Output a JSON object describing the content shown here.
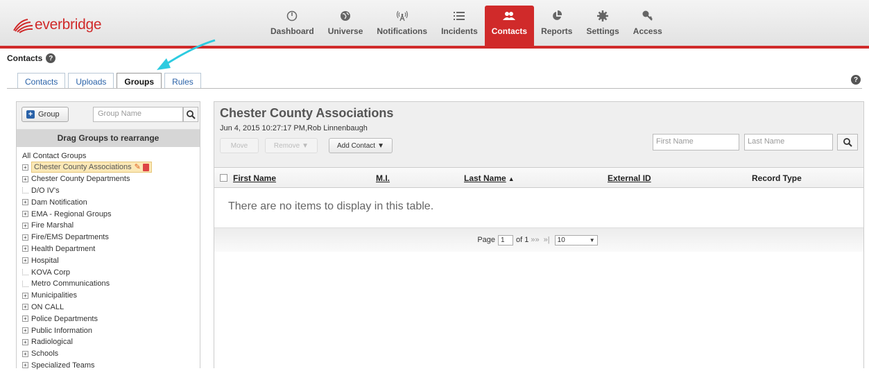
{
  "brand": {
    "logo_text": "everbridge",
    "accent": "#d02a2a",
    "link": "#2a62a8"
  },
  "nav": [
    {
      "label": "Dashboard",
      "icon": "dashboard-icon"
    },
    {
      "label": "Universe",
      "icon": "globe-icon"
    },
    {
      "label": "Notifications",
      "icon": "broadcast-icon"
    },
    {
      "label": "Incidents",
      "icon": "list-icon"
    },
    {
      "label": "Contacts",
      "icon": "people-icon",
      "active": true
    },
    {
      "label": "Reports",
      "icon": "pie-chart-icon"
    },
    {
      "label": "Settings",
      "icon": "gear-icon"
    },
    {
      "label": "Access",
      "icon": "key-icon"
    }
  ],
  "page": {
    "title": "Contacts",
    "help": "?"
  },
  "tabs": [
    {
      "label": "Contacts"
    },
    {
      "label": "Uploads"
    },
    {
      "label": "Groups",
      "active": true
    },
    {
      "label": "Rules"
    }
  ],
  "left": {
    "add_button": "Group",
    "search_placeholder": "Group Name",
    "drag_header": "Drag Groups to rearrange",
    "root": "All Contact Groups",
    "groups": [
      {
        "label": "Chester County Associations",
        "expandable": true,
        "selected": true
      },
      {
        "label": "Chester County Departments",
        "expandable": true
      },
      {
        "label": "D/O IV's",
        "expandable": false
      },
      {
        "label": "Dam Notification",
        "expandable": true
      },
      {
        "label": "EMA - Regional Groups",
        "expandable": true
      },
      {
        "label": "Fire Marshal",
        "expandable": true
      },
      {
        "label": "Fire/EMS Departments",
        "expandable": true
      },
      {
        "label": "Health Department",
        "expandable": true
      },
      {
        "label": "Hospital",
        "expandable": true
      },
      {
        "label": "KOVA Corp",
        "expandable": false
      },
      {
        "label": "Metro Communications",
        "expandable": false
      },
      {
        "label": "Municipalities",
        "expandable": true
      },
      {
        "label": "ON CALL",
        "expandable": true
      },
      {
        "label": "Police Departments",
        "expandable": true
      },
      {
        "label": "Public Information",
        "expandable": true
      },
      {
        "label": "Radiological",
        "expandable": true
      },
      {
        "label": "Schools",
        "expandable": true
      },
      {
        "label": "Specialized Teams",
        "expandable": true
      }
    ]
  },
  "right": {
    "title": "Chester County Associations",
    "subtitle": "Jun 4, 2015 10:27:17 PM,Rob Linnenbaugh",
    "buttons": {
      "move": "Move",
      "remove": "Remove",
      "add_contact": "Add Contact"
    },
    "filters": {
      "first_name": "First Name",
      "last_name": "Last Name"
    },
    "columns": {
      "first_name": "First Name",
      "mi": "M.I.",
      "last_name": "Last Name",
      "external_id": "External ID",
      "record_type": "Record Type"
    },
    "empty_message": "There are no items to display in this table.",
    "pager": {
      "page_label": "Page",
      "page_value": "1",
      "of_label": "of 1",
      "next": "»»",
      "last": "»|",
      "page_size": "10"
    }
  }
}
